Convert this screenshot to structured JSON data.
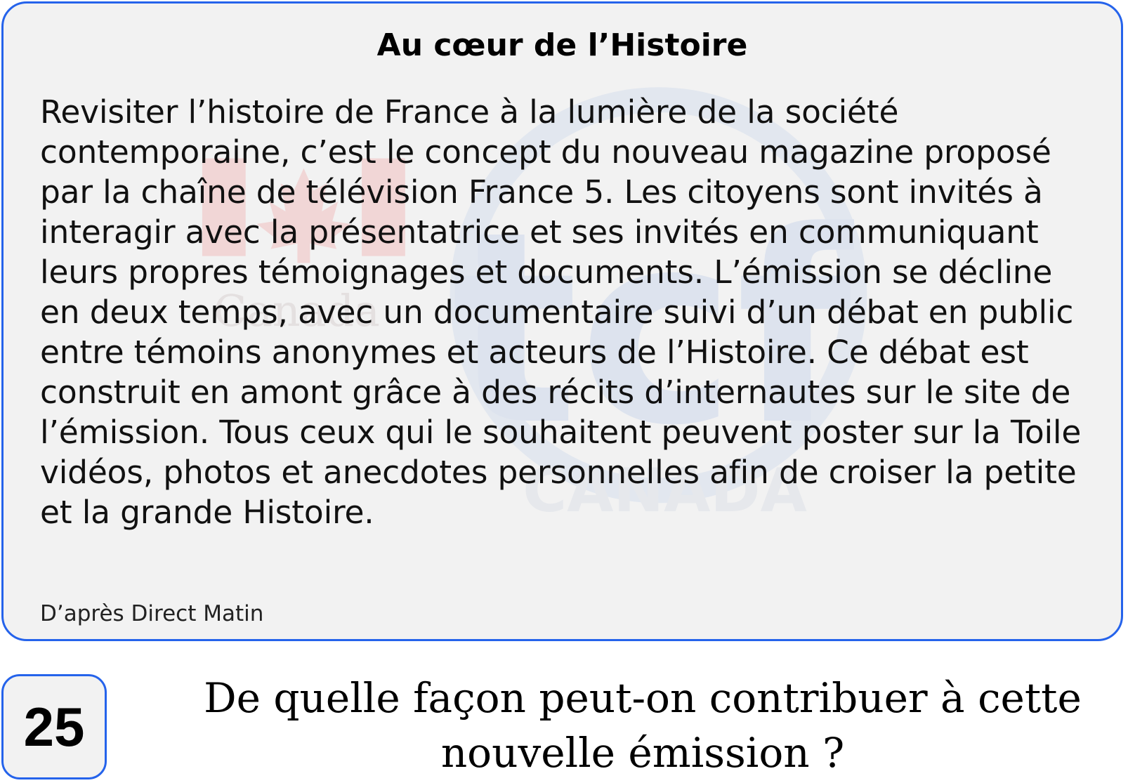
{
  "card": {
    "title": "Au cœur de l’Histoire",
    "body": "Revisiter l’histoire de France à la lumière de la société contemporaine, c’est le concept du nouveau magazine proposé par la chaîne de télévision France 5. Les citoyens sont invités à interagir avec la présentatrice et ses invités en communiquant leurs propres témoignages et documents. L’émission se décline en deux temps, avec un documentaire suivi d’un débat en public entre témoins anonymes et acteurs de l’Histoire. Ce débat est construit en amont grâce à des récits d’internautes sur le site de l’émission. Tous ceux qui le souhaitent peuvent poster sur la Toile vidéos, photos et anecdotes personnelles afin de croiser la petite et la grande Histoire.",
    "source": "D’après Direct Matin"
  },
  "watermark": {
    "left_text": "Canada",
    "logo_text": "tcf",
    "country_text": "CANADA"
  },
  "question": {
    "number": "25",
    "text": "De quelle façon peut-on contribuer à cette nouvelle émission ?"
  },
  "colors": {
    "border": "#2563eb",
    "card_background": "#f2f2f2",
    "watermark_red": "#f1d6d6",
    "watermark_blue": "#dde3ee"
  }
}
